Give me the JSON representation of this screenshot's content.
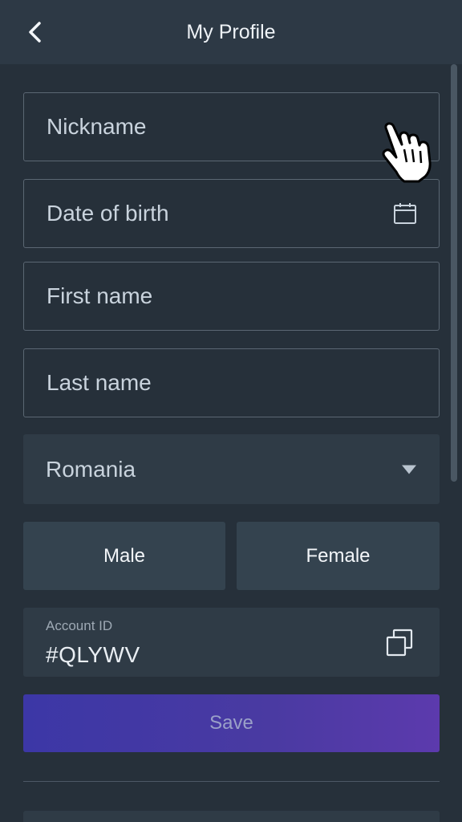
{
  "header": {
    "title": "My Profile",
    "back_icon": "chevron-left-icon"
  },
  "form": {
    "nickname_placeholder": "Nickname",
    "dob_placeholder": "Date of birth",
    "dob_icon": "calendar-icon",
    "first_name_placeholder": "First name",
    "last_name_placeholder": "Last name",
    "country_value": "Romania",
    "gender_male": "Male",
    "gender_female": "Female",
    "account_id_label": "Account ID",
    "account_id_value": "#QLYWV",
    "copy_icon": "copy-icon",
    "save_label": "Save"
  },
  "colors": {
    "background": "#26303a",
    "header": "#2d3945",
    "accent_start": "#3c37a6",
    "accent_end": "#5c3aad"
  }
}
